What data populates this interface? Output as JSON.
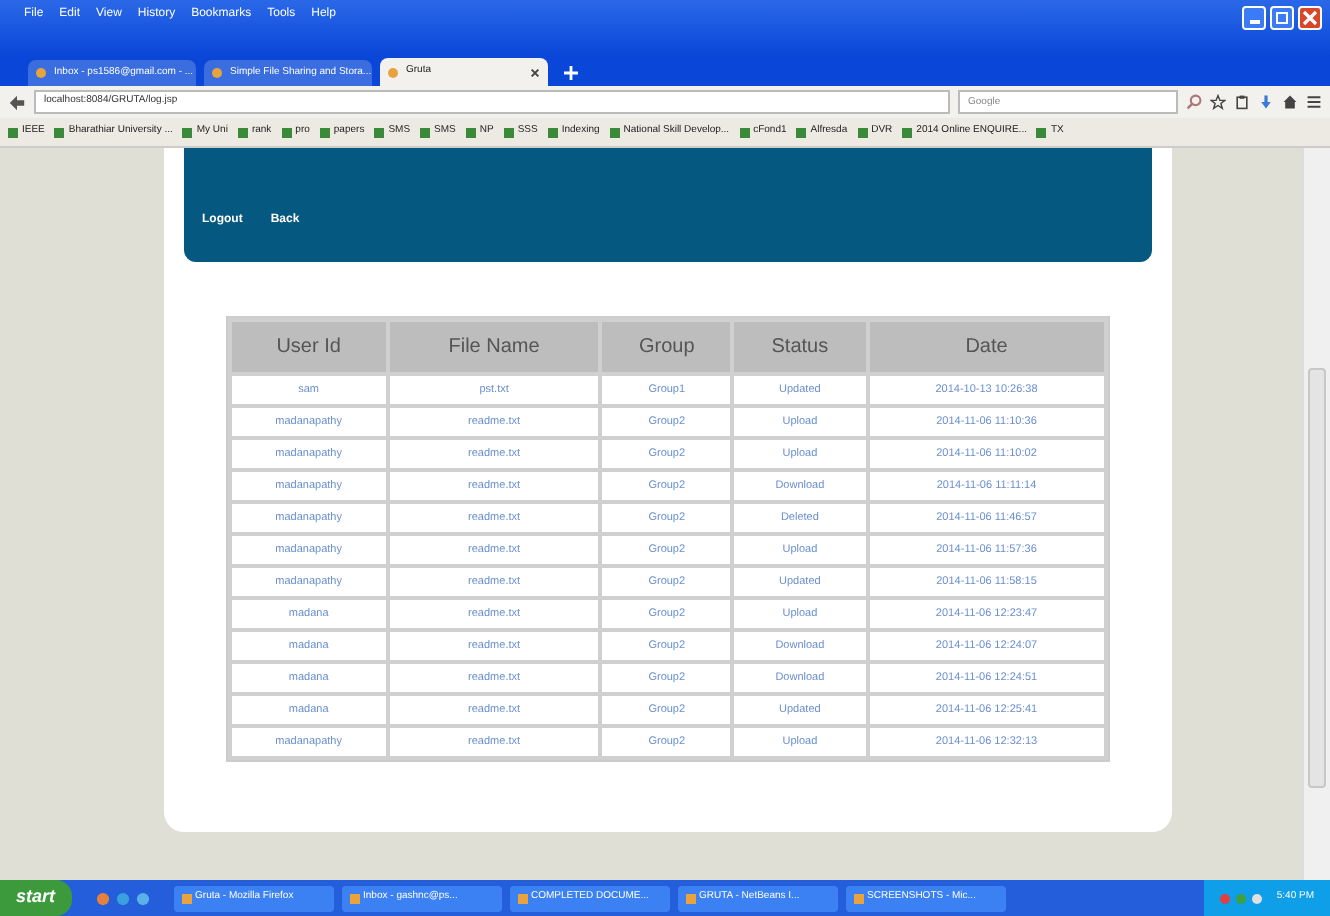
{
  "menu": [
    "File",
    "Edit",
    "View",
    "History",
    "Bookmarks",
    "Tools",
    "Help"
  ],
  "tabs": [
    {
      "label": "Inbox - ps1586@gmail.com - ...",
      "selected": false
    },
    {
      "label": "Simple File Sharing and Stora...",
      "selected": false
    },
    {
      "label": "Gruta",
      "selected": true
    }
  ],
  "address": "localhost:8084/GRUTA/log.jsp",
  "search": {
    "placeholder": "Google"
  },
  "bookmarks": [
    "IEEE",
    "Bharathiar University ...",
    "My Uni",
    "rank",
    "pro",
    "papers",
    "SMS",
    "SMS",
    "NP",
    "SSS",
    "Indexing",
    "National Skill Develop...",
    "cFond1",
    "Alfresda",
    "DVR",
    "2014 Online ENQUIRE...",
    "TX"
  ],
  "nav": [
    "Logout",
    "Back"
  ],
  "table": {
    "columns": [
      "User Id",
      "File Name",
      "Group",
      "Status",
      "Date"
    ],
    "rows": [
      [
        "sam",
        "pst.txt",
        "Group1",
        "Updated",
        "2014-10-13 10:26:38"
      ],
      [
        "madanapathy",
        "readme.txt",
        "Group2",
        "Upload",
        "2014-11-06 11:10:36"
      ],
      [
        "madanapathy",
        "readme.txt",
        "Group2",
        "Upload",
        "2014-11-06 11:10:02"
      ],
      [
        "madanapathy",
        "readme.txt",
        "Group2",
        "Download",
        "2014-11-06 11:11:14"
      ],
      [
        "madanapathy",
        "readme.txt",
        "Group2",
        "Deleted",
        "2014-11-06 11:46:57"
      ],
      [
        "madanapathy",
        "readme.txt",
        "Group2",
        "Upload",
        "2014-11-06 11:57:36"
      ],
      [
        "madanapathy",
        "readme.txt",
        "Group2",
        "Updated",
        "2014-11-06 11:58:15"
      ],
      [
        "madana",
        "readme.txt",
        "Group2",
        "Upload",
        "2014-11-06 12:23:47"
      ],
      [
        "madana",
        "readme.txt",
        "Group2",
        "Download",
        "2014-11-06 12:24:07"
      ],
      [
        "madana",
        "readme.txt",
        "Group2",
        "Download",
        "2014-11-06 12:24:51"
      ],
      [
        "madana",
        "readme.txt",
        "Group2",
        "Updated",
        "2014-11-06 12:25:41"
      ],
      [
        "madanapathy",
        "readme.txt",
        "Group2",
        "Upload",
        "2014-11-06 12:32:13"
      ]
    ]
  },
  "taskbar": {
    "start": "start",
    "items": [
      "Gruta - Mozilla Firefox",
      "Inbox - gashnc@ps...",
      "COMPLETED DOCUME...",
      "GRUTA - NetBeans I...",
      "SCREENSHOTS - Mic..."
    ],
    "clock": "5:40 PM"
  }
}
